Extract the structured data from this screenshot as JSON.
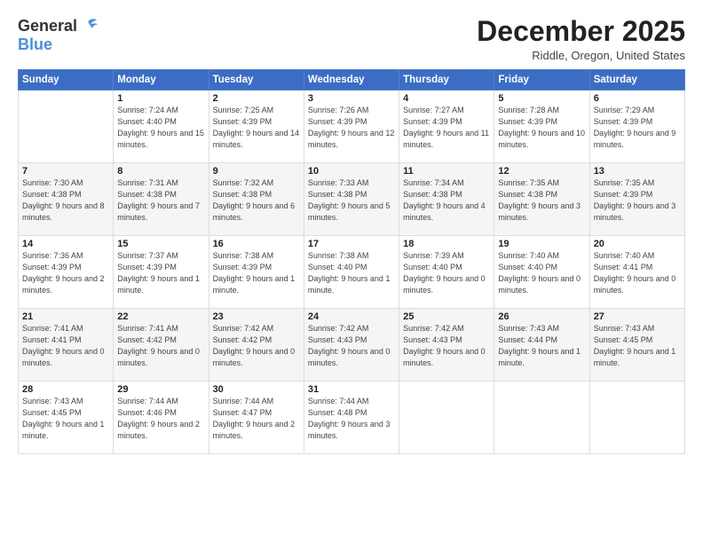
{
  "logo": {
    "general": "General",
    "blue": "Blue"
  },
  "title": "December 2025",
  "location": "Riddle, Oregon, United States",
  "days_of_week": [
    "Sunday",
    "Monday",
    "Tuesday",
    "Wednesday",
    "Thursday",
    "Friday",
    "Saturday"
  ],
  "weeks": [
    [
      {
        "day": "",
        "sunrise": "",
        "sunset": "",
        "daylight": ""
      },
      {
        "day": "1",
        "sunrise": "Sunrise: 7:24 AM",
        "sunset": "Sunset: 4:40 PM",
        "daylight": "Daylight: 9 hours and 15 minutes."
      },
      {
        "day": "2",
        "sunrise": "Sunrise: 7:25 AM",
        "sunset": "Sunset: 4:39 PM",
        "daylight": "Daylight: 9 hours and 14 minutes."
      },
      {
        "day": "3",
        "sunrise": "Sunrise: 7:26 AM",
        "sunset": "Sunset: 4:39 PM",
        "daylight": "Daylight: 9 hours and 12 minutes."
      },
      {
        "day": "4",
        "sunrise": "Sunrise: 7:27 AM",
        "sunset": "Sunset: 4:39 PM",
        "daylight": "Daylight: 9 hours and 11 minutes."
      },
      {
        "day": "5",
        "sunrise": "Sunrise: 7:28 AM",
        "sunset": "Sunset: 4:39 PM",
        "daylight": "Daylight: 9 hours and 10 minutes."
      },
      {
        "day": "6",
        "sunrise": "Sunrise: 7:29 AM",
        "sunset": "Sunset: 4:39 PM",
        "daylight": "Daylight: 9 hours and 9 minutes."
      }
    ],
    [
      {
        "day": "7",
        "sunrise": "Sunrise: 7:30 AM",
        "sunset": "Sunset: 4:38 PM",
        "daylight": "Daylight: 9 hours and 8 minutes."
      },
      {
        "day": "8",
        "sunrise": "Sunrise: 7:31 AM",
        "sunset": "Sunset: 4:38 PM",
        "daylight": "Daylight: 9 hours and 7 minutes."
      },
      {
        "day": "9",
        "sunrise": "Sunrise: 7:32 AM",
        "sunset": "Sunset: 4:38 PM",
        "daylight": "Daylight: 9 hours and 6 minutes."
      },
      {
        "day": "10",
        "sunrise": "Sunrise: 7:33 AM",
        "sunset": "Sunset: 4:38 PM",
        "daylight": "Daylight: 9 hours and 5 minutes."
      },
      {
        "day": "11",
        "sunrise": "Sunrise: 7:34 AM",
        "sunset": "Sunset: 4:38 PM",
        "daylight": "Daylight: 9 hours and 4 minutes."
      },
      {
        "day": "12",
        "sunrise": "Sunrise: 7:35 AM",
        "sunset": "Sunset: 4:38 PM",
        "daylight": "Daylight: 9 hours and 3 minutes."
      },
      {
        "day": "13",
        "sunrise": "Sunrise: 7:35 AM",
        "sunset": "Sunset: 4:39 PM",
        "daylight": "Daylight: 9 hours and 3 minutes."
      }
    ],
    [
      {
        "day": "14",
        "sunrise": "Sunrise: 7:36 AM",
        "sunset": "Sunset: 4:39 PM",
        "daylight": "Daylight: 9 hours and 2 minutes."
      },
      {
        "day": "15",
        "sunrise": "Sunrise: 7:37 AM",
        "sunset": "Sunset: 4:39 PM",
        "daylight": "Daylight: 9 hours and 1 minute."
      },
      {
        "day": "16",
        "sunrise": "Sunrise: 7:38 AM",
        "sunset": "Sunset: 4:39 PM",
        "daylight": "Daylight: 9 hours and 1 minute."
      },
      {
        "day": "17",
        "sunrise": "Sunrise: 7:38 AM",
        "sunset": "Sunset: 4:40 PM",
        "daylight": "Daylight: 9 hours and 1 minute."
      },
      {
        "day": "18",
        "sunrise": "Sunrise: 7:39 AM",
        "sunset": "Sunset: 4:40 PM",
        "daylight": "Daylight: 9 hours and 0 minutes."
      },
      {
        "day": "19",
        "sunrise": "Sunrise: 7:40 AM",
        "sunset": "Sunset: 4:40 PM",
        "daylight": "Daylight: 9 hours and 0 minutes."
      },
      {
        "day": "20",
        "sunrise": "Sunrise: 7:40 AM",
        "sunset": "Sunset: 4:41 PM",
        "daylight": "Daylight: 9 hours and 0 minutes."
      }
    ],
    [
      {
        "day": "21",
        "sunrise": "Sunrise: 7:41 AM",
        "sunset": "Sunset: 4:41 PM",
        "daylight": "Daylight: 9 hours and 0 minutes."
      },
      {
        "day": "22",
        "sunrise": "Sunrise: 7:41 AM",
        "sunset": "Sunset: 4:42 PM",
        "daylight": "Daylight: 9 hours and 0 minutes."
      },
      {
        "day": "23",
        "sunrise": "Sunrise: 7:42 AM",
        "sunset": "Sunset: 4:42 PM",
        "daylight": "Daylight: 9 hours and 0 minutes."
      },
      {
        "day": "24",
        "sunrise": "Sunrise: 7:42 AM",
        "sunset": "Sunset: 4:43 PM",
        "daylight": "Daylight: 9 hours and 0 minutes."
      },
      {
        "day": "25",
        "sunrise": "Sunrise: 7:42 AM",
        "sunset": "Sunset: 4:43 PM",
        "daylight": "Daylight: 9 hours and 0 minutes."
      },
      {
        "day": "26",
        "sunrise": "Sunrise: 7:43 AM",
        "sunset": "Sunset: 4:44 PM",
        "daylight": "Daylight: 9 hours and 1 minute."
      },
      {
        "day": "27",
        "sunrise": "Sunrise: 7:43 AM",
        "sunset": "Sunset: 4:45 PM",
        "daylight": "Daylight: 9 hours and 1 minute."
      }
    ],
    [
      {
        "day": "28",
        "sunrise": "Sunrise: 7:43 AM",
        "sunset": "Sunset: 4:45 PM",
        "daylight": "Daylight: 9 hours and 1 minute."
      },
      {
        "day": "29",
        "sunrise": "Sunrise: 7:44 AM",
        "sunset": "Sunset: 4:46 PM",
        "daylight": "Daylight: 9 hours and 2 minutes."
      },
      {
        "day": "30",
        "sunrise": "Sunrise: 7:44 AM",
        "sunset": "Sunset: 4:47 PM",
        "daylight": "Daylight: 9 hours and 2 minutes."
      },
      {
        "day": "31",
        "sunrise": "Sunrise: 7:44 AM",
        "sunset": "Sunset: 4:48 PM",
        "daylight": "Daylight: 9 hours and 3 minutes."
      },
      {
        "day": "",
        "sunrise": "",
        "sunset": "",
        "daylight": ""
      },
      {
        "day": "",
        "sunrise": "",
        "sunset": "",
        "daylight": ""
      },
      {
        "day": "",
        "sunrise": "",
        "sunset": "",
        "daylight": ""
      }
    ]
  ]
}
